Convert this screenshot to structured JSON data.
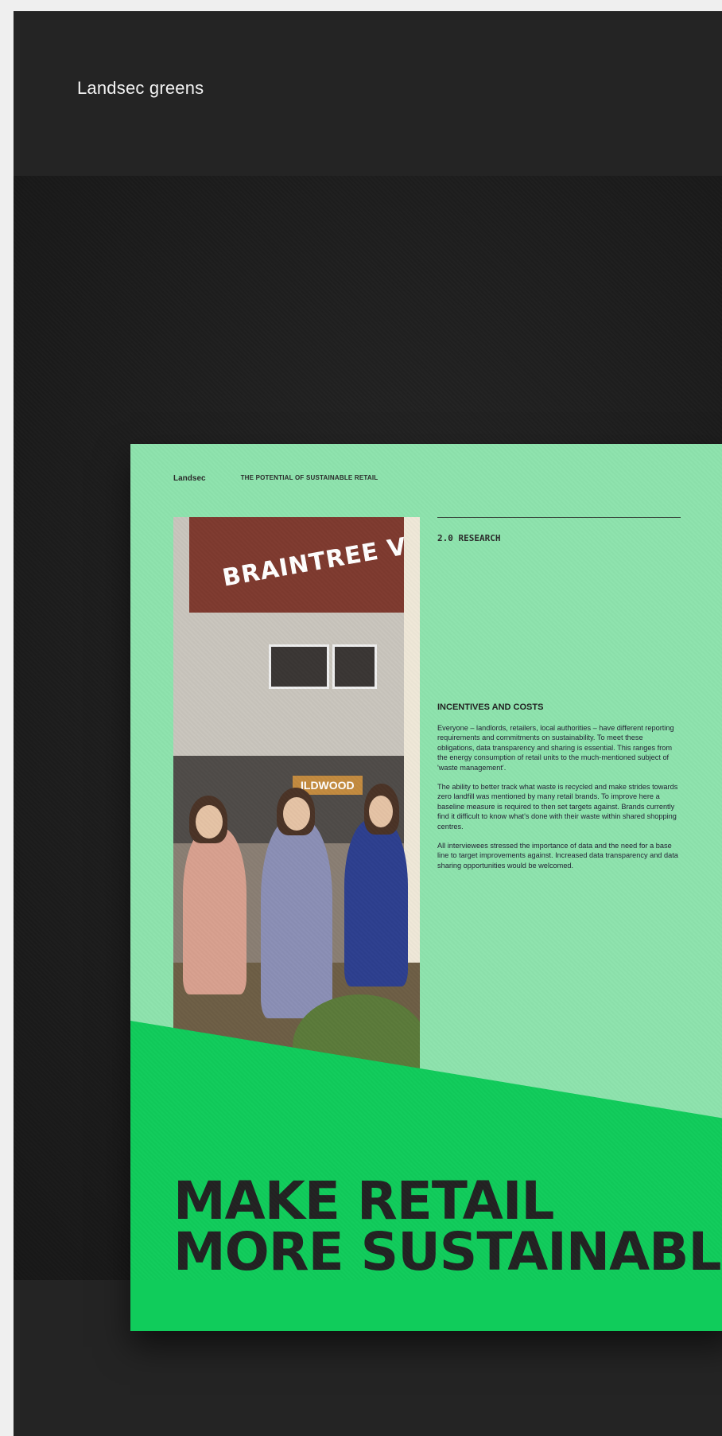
{
  "page": {
    "brand_title": "Landsec greens"
  },
  "brochure": {
    "header": {
      "logo": "Landsec",
      "series": "THE POTENTIAL OF SUSTAINABLE RETAIL"
    },
    "section_label": "2.0 RESEARCH",
    "photo": {
      "sign_text": "BRAINTREE VILL",
      "shop_sign": "ILDWOOD"
    },
    "article": {
      "heading": "INCENTIVES AND COSTS",
      "paragraphs": [
        "Everyone – landlords, retailers, local authorities – have different reporting requirements and commitments on sustainability. To meet these obligations, data transparency and sharing is essential. This ranges from the energy consumption of retail units to the much-mentioned subject of 'waste management'.",
        "The ability to better track what waste is recycled and make strides towards zero landfill was mentioned by many retail brands. To improve here a baseline measure is required to then set targets against. Brands currently find it difficult to know what's done with their waste within shared shopping centres.",
        "All interviewees stressed the importance of data and the need for a base line to target improvements against. Increased data transparency and data sharing opportunities would be welcomed."
      ]
    },
    "headline": {
      "line1": "MAKE RETAIL",
      "line2": "MORE SUSTAINABLE"
    }
  },
  "colors": {
    "mint": "#8ee3ad",
    "green": "#10cc5b",
    "dark": "#242424"
  }
}
